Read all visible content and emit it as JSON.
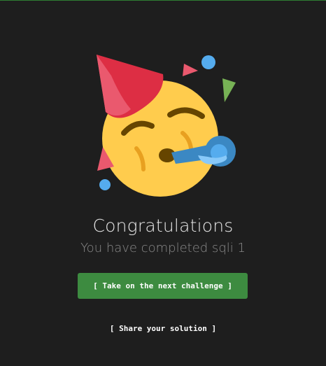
{
  "illustration": {
    "icon": "partying-face-emoji",
    "colors": {
      "face": "#ffcc4d",
      "hat": "#dd2e44",
      "hat_highlight": "#ea596e",
      "blower": "#3b88c3",
      "blower_tip": "#88c9f9",
      "confetti_blue": "#55acee",
      "confetti_green": "#77b255",
      "confetti_pink": "#ea596e",
      "features": "#664500",
      "cheek": "#e8a020"
    }
  },
  "message": {
    "title": "Congratulations",
    "subtitle": "You have completed sqli 1"
  },
  "actions": {
    "next_challenge_label": "[ Take on the next challenge ]",
    "share_solution_label": "[ Share your solution ]"
  },
  "theme": {
    "background": "#1e1e1e",
    "accent_green": "#3d8b40"
  }
}
